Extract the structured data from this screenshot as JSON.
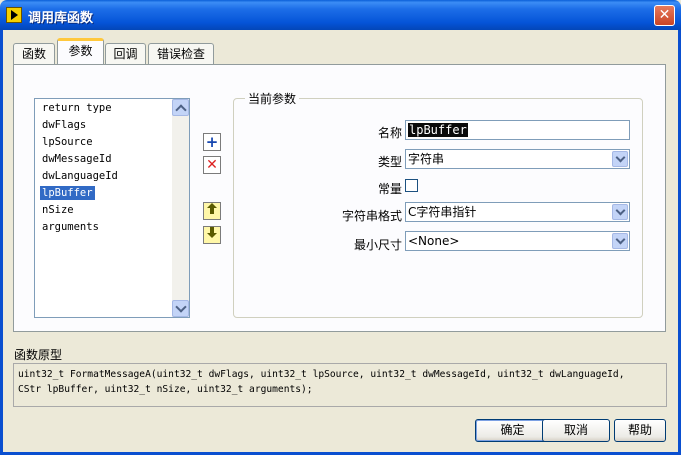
{
  "window": {
    "title": "调用库函数",
    "close_label": "✕"
  },
  "tabs": [
    {
      "label": "函数"
    },
    {
      "label": "参数"
    },
    {
      "label": "回调"
    },
    {
      "label": "错误检查"
    }
  ],
  "active_tab": "参数",
  "param_list": {
    "items": [
      "return type",
      "dwFlags",
      "lpSource",
      "dwMessageId",
      "dwLanguageId",
      "lpBuffer",
      "nSize",
      "arguments"
    ],
    "selected": "lpBuffer"
  },
  "side_buttons": {
    "add": "+",
    "delete": "✕"
  },
  "current_param": {
    "group_label": "当前参数",
    "name_label": "名称",
    "name_value": "lpBuffer",
    "type_label": "类型",
    "type_value": "字符串",
    "const_label": "常量",
    "const_checked": false,
    "string_format_label": "字符串格式",
    "string_format_value": "C字符串指针",
    "min_size_label": "最小尺寸",
    "min_size_value": "<None>"
  },
  "prototype": {
    "label": "函数原型",
    "line1": "uint32_t FormatMessageA(uint32_t dwFlags, uint32_t lpSource, uint32_t dwMessageId, uint32_t dwLanguageId,",
    "line2": "CStr lpBuffer, uint32_t nSize, uint32_t arguments);"
  },
  "buttons": {
    "ok": "确定",
    "cancel": "取消",
    "help": "帮助"
  }
}
